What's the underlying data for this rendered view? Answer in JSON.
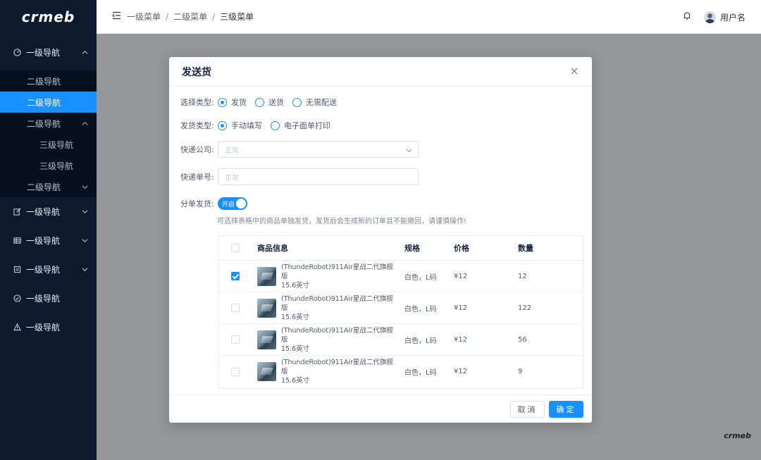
{
  "sidebar": {
    "logo": "crmeb",
    "groups": [
      {
        "label": "一级导航",
        "icon": "dashboard-icon",
        "open": true
      },
      {
        "label": "一级导航",
        "icon": "edit-icon"
      },
      {
        "label": "一级导航",
        "icon": "table-icon"
      },
      {
        "label": "一级导航",
        "icon": "list-icon"
      },
      {
        "label": "一级导航",
        "icon": "check-circle-icon"
      },
      {
        "label": "一级导航",
        "icon": "warning-icon"
      }
    ],
    "sub": [
      {
        "label": "二级导航"
      },
      {
        "label": "二级导航",
        "active": true
      },
      {
        "label": "二级导航",
        "open": true
      },
      {
        "label": "二级导航"
      }
    ],
    "third": [
      {
        "label": "三级导航"
      },
      {
        "label": "三级导航"
      }
    ]
  },
  "header": {
    "breadcrumb": [
      "一级菜单",
      "二级菜单",
      "三级菜单"
    ],
    "separator": "/",
    "username": "用户名"
  },
  "modal": {
    "title": "发送货",
    "select_type": {
      "label": "选择类型:",
      "options": [
        "发货",
        "送货",
        "无需配送"
      ],
      "selected": 0
    },
    "ship_type": {
      "label": "发货类型:",
      "options": [
        "手动填写",
        "电子面单打印"
      ],
      "selected": 0
    },
    "courier": {
      "label": "快递公司:",
      "placeholder": "正常"
    },
    "tracking": {
      "label": "快递单号:",
      "placeholder": "正常"
    },
    "split": {
      "label": "分单发货:",
      "switch_text": "开启",
      "on": true
    },
    "hint": "可选择表格中的商品单独发货，发货后会生成新的订单且不能撤回，请谨慎操作!",
    "table": {
      "columns": [
        "商品信息",
        "规格",
        "价格",
        "数量"
      ],
      "rows": [
        {
          "name_line1": "(ThundeRobot)911Air星战二代旗舰版",
          "name_line2": "15.6英寸",
          "spec": "白色，L码",
          "price": "¥12",
          "qty": "12",
          "checked": true
        },
        {
          "name_line1": "(ThundeRobot)911Air星战二代旗舰版",
          "name_line2": "15.6英寸",
          "spec": "白色，L码",
          "price": "¥12",
          "qty": "122",
          "checked": false
        },
        {
          "name_line1": "(ThundeRobot)911Air星战二代旗舰版",
          "name_line2": "15.6英寸",
          "spec": "白色，L码",
          "price": "¥12",
          "qty": "56",
          "checked": false
        },
        {
          "name_line1": "(ThundeRobot)911Air星战二代旗舰版",
          "name_line2": "15.6英寸",
          "spec": "白色，L码",
          "price": "¥12",
          "qty": "9",
          "checked": false
        }
      ]
    },
    "cancel_label": "取消",
    "ok_label": "确定"
  },
  "corner_logo": "crmeb",
  "colors": {
    "primary": "#1890ff",
    "sidebar_bg": "#0e1b2e"
  }
}
